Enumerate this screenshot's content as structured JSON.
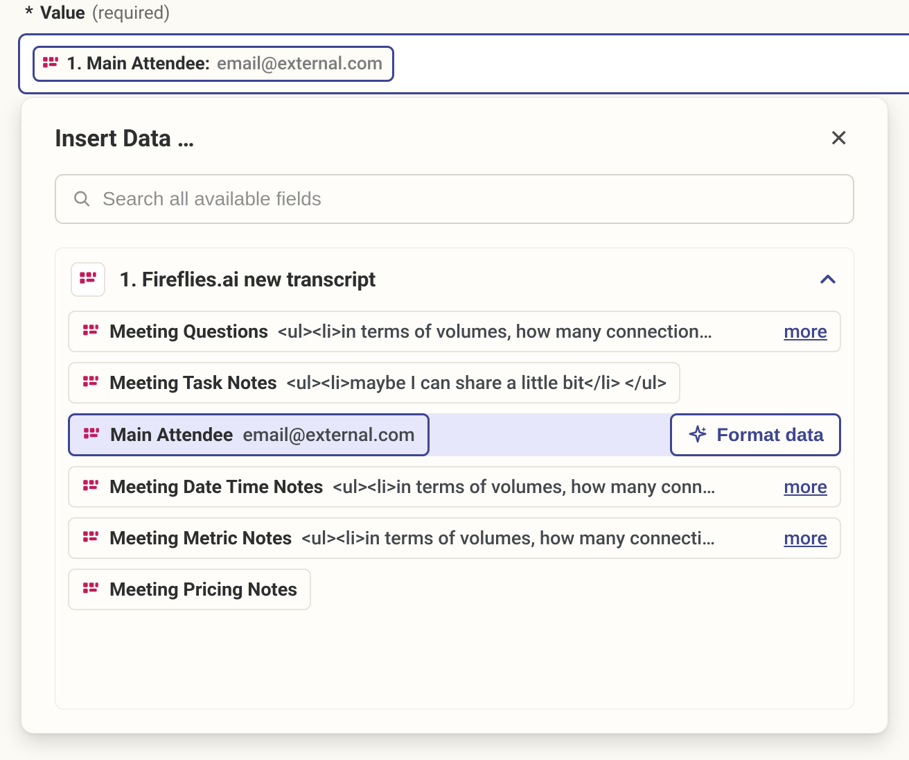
{
  "field": {
    "label": "Value",
    "required_text": "(required)",
    "asterisk": "*"
  },
  "chip": {
    "prefix": "1. Main Attendee:",
    "value": "email@external.com"
  },
  "popover": {
    "title": "Insert Data …",
    "search_placeholder": "Search all available fields",
    "group_title": "1. Fireflies.ai new transcript",
    "more_label": "more",
    "format_label": "Format data",
    "options": [
      {
        "name": "Meeting Questions",
        "value": "<ul><li>in terms of volumes, how many connection…",
        "more": true
      },
      {
        "name": "Meeting Task Notes",
        "value": "<ul><li>maybe I can share a little bit</li> </ul>",
        "more": false
      },
      {
        "name": "Main Attendee",
        "value": "email@external.com",
        "selected": true
      },
      {
        "name": "Meeting Date Time Notes",
        "value": "<ul><li>in terms of volumes, how many conn…",
        "more": true
      },
      {
        "name": "Meeting Metric Notes",
        "value": "<ul><li>in terms of volumes, how many connecti…",
        "more": true
      },
      {
        "name": "Meeting Pricing Notes",
        "value": "",
        "more": false
      }
    ]
  }
}
